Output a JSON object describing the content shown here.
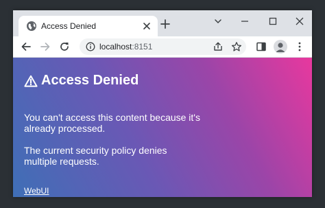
{
  "browser": {
    "tab": {
      "title": "Access Denied",
      "favicon": "globe-icon"
    },
    "address_bar": {
      "host": "localhost",
      "port": ":8151"
    },
    "icons": {
      "back": "back-arrow-icon",
      "forward": "forward-arrow-icon",
      "reload": "reload-icon",
      "share": "share-icon",
      "bookmark": "star-icon",
      "side_panel": "side-panel-icon",
      "profile": "profile-icon",
      "menu": "kebab-menu-icon"
    }
  },
  "page": {
    "heading_icon": "warning-icon",
    "heading": "Access Denied",
    "message_line1": "You can't access this content because it's already processed.",
    "message_line2": "The current security policy denies multiple requests.",
    "link_label": "WebUI"
  },
  "colors": {
    "gradient_start": "#3f6fb6",
    "gradient_mid": "#9b45a8",
    "gradient_end": "#e8389e",
    "tabstrip": "#dee1e6",
    "desktop": "#2b3035"
  }
}
